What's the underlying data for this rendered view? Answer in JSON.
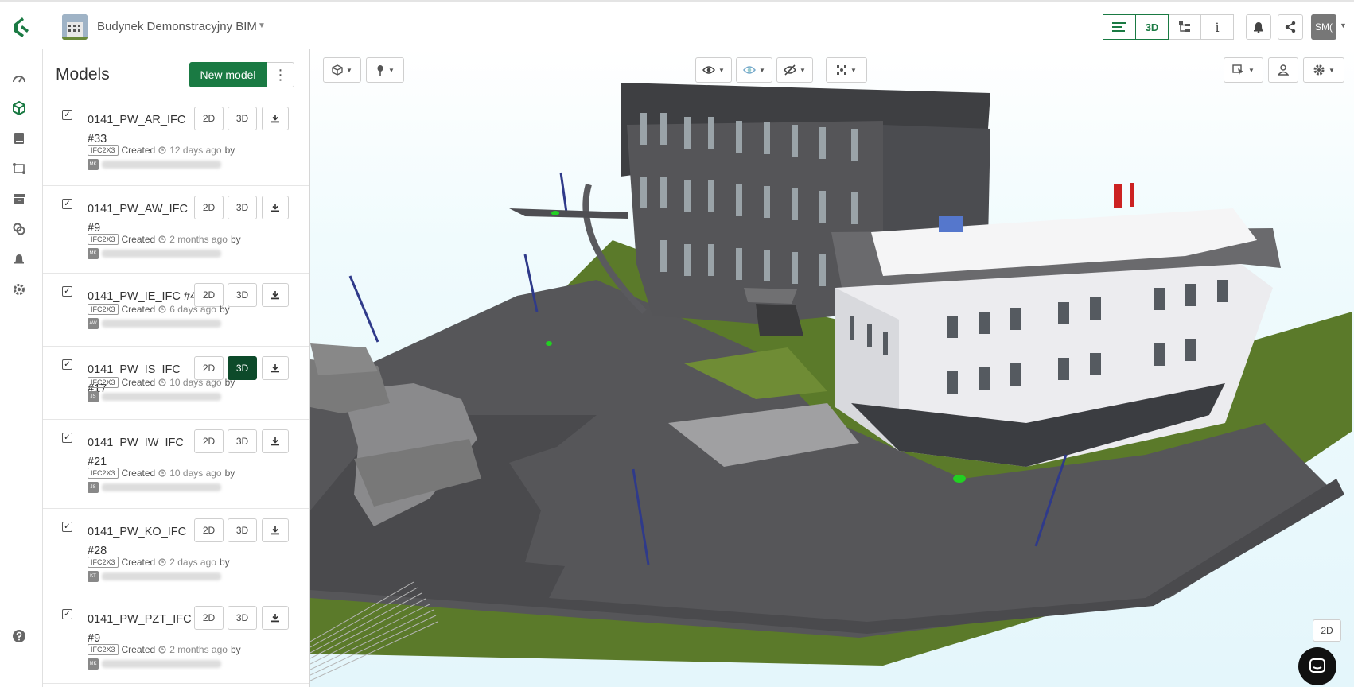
{
  "project": {
    "name": "Budynek Demonstracyjny BIM"
  },
  "header": {
    "views": [
      {
        "label": "",
        "icon": "list-icon"
      },
      {
        "label": "3D",
        "icon": ""
      },
      {
        "label": "",
        "icon": "tree-icon"
      },
      {
        "label": "i",
        "icon": "info-icon"
      }
    ],
    "user_initials": "SM("
  },
  "panel": {
    "title": "Models",
    "new_model_label": "New model",
    "models": [
      {
        "name": "0141_PW_AR_IFC #33",
        "format": "IFC2X3",
        "created": "Created",
        "ago": "12 days ago",
        "by": "by",
        "avatar": "MK",
        "btn2d": "2D",
        "btn3d": "3D",
        "active3d": false
      },
      {
        "name": "0141_PW_AW_IFC #9",
        "format": "IFC2X3",
        "created": "Created",
        "ago": "2 months ago",
        "by": "by",
        "avatar": "MK",
        "btn2d": "2D",
        "btn3d": "3D",
        "active3d": false
      },
      {
        "name": "0141_PW_IE_IFC #4",
        "format": "IFC2X3",
        "created": "Created",
        "ago": "6 days ago",
        "by": "by",
        "avatar": "AW",
        "btn2d": "2D",
        "btn3d": "3D",
        "active3d": false
      },
      {
        "name": "0141_PW_IS_IFC #17",
        "format": "IFC2X3",
        "created": "Created",
        "ago": "10 days ago",
        "by": "by",
        "avatar": "JS",
        "btn2d": "2D",
        "btn3d": "3D",
        "active3d": true
      },
      {
        "name": "0141_PW_IW_IFC #21",
        "format": "IFC2X3",
        "created": "Created",
        "ago": "10 days ago",
        "by": "by",
        "avatar": "JS",
        "btn2d": "2D",
        "btn3d": "3D",
        "active3d": false
      },
      {
        "name": "0141_PW_KO_IFC #28",
        "format": "IFC2X3",
        "created": "Created",
        "ago": "2 days ago",
        "by": "by",
        "avatar": "KT",
        "btn2d": "2D",
        "btn3d": "3D",
        "active3d": false
      },
      {
        "name": "0141_PW_PZT_IFC #9",
        "format": "IFC2X3",
        "created": "Created",
        "ago": "2 months ago",
        "by": "by",
        "avatar": "MK",
        "btn2d": "2D",
        "btn3d": "3D",
        "active3d": false
      }
    ]
  },
  "viewer": {
    "mode_2d_label": "2D"
  },
  "colors": {
    "accent": "#1a7a43",
    "accent_dark": "#0d4a2a"
  }
}
